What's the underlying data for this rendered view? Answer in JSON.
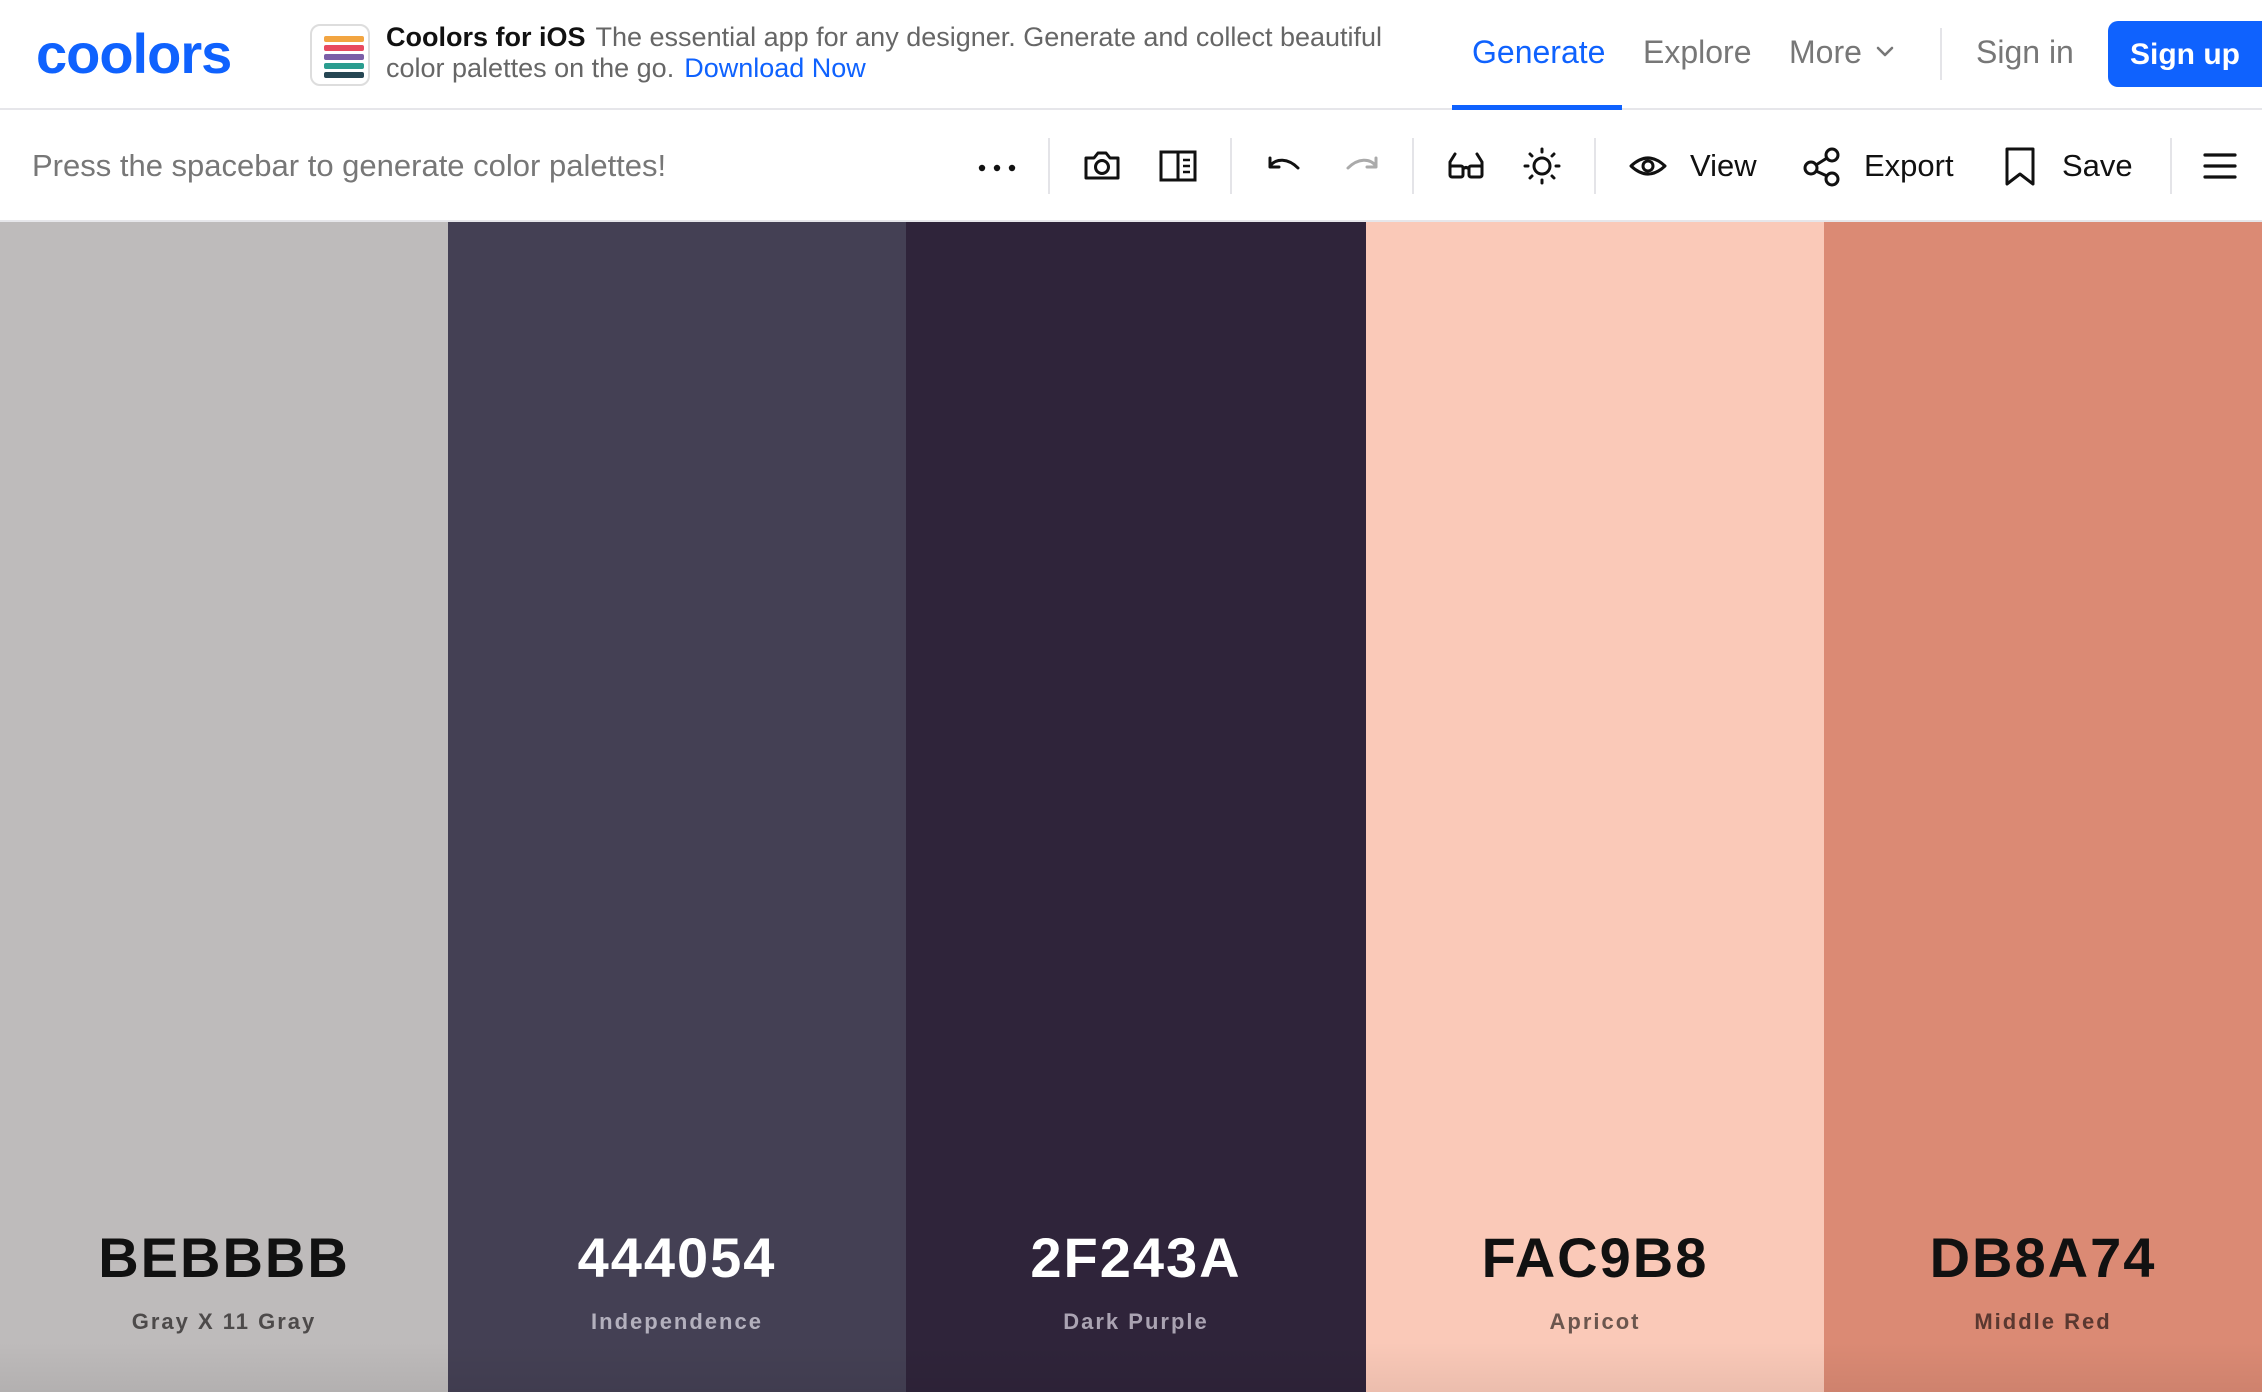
{
  "header": {
    "logo": "coolors",
    "promo": {
      "title": "Coolors for iOS",
      "text": "The essential app for any designer. Generate and collect beautiful color palettes on the go.",
      "link": "Download Now"
    },
    "nav": {
      "generate": "Generate",
      "explore": "Explore",
      "more": "More",
      "signin": "Sign in",
      "signup": "Sign up"
    }
  },
  "toolbar": {
    "hint": "Press the spacebar to generate color palettes!",
    "view_label": "View",
    "export_label": "Export",
    "save_label": "Save"
  },
  "palette": [
    {
      "hex": "BEBBBB",
      "name": "Gray X 11 Gray",
      "color": "#BEBBBB",
      "text_color": "#111111",
      "sub_color": "#4d4a4a"
    },
    {
      "hex": "444054",
      "name": "Independence",
      "color": "#444054",
      "text_color": "#ffffff",
      "sub_color": "#b3b0bd"
    },
    {
      "hex": "2F243A",
      "name": "Dark Purple",
      "color": "#2F243A",
      "text_color": "#ffffff",
      "sub_color": "#aaa3b2"
    },
    {
      "hex": "FAC9B8",
      "name": "Apricot",
      "color": "#FAC9B8",
      "text_color": "#111111",
      "sub_color": "#6b564e"
    },
    {
      "hex": "DB8A74",
      "name": "Middle Red",
      "color": "#DB8A74",
      "text_color": "#111111",
      "sub_color": "#5a3830"
    }
  ],
  "colors": {
    "accent": "#0f62fe"
  }
}
